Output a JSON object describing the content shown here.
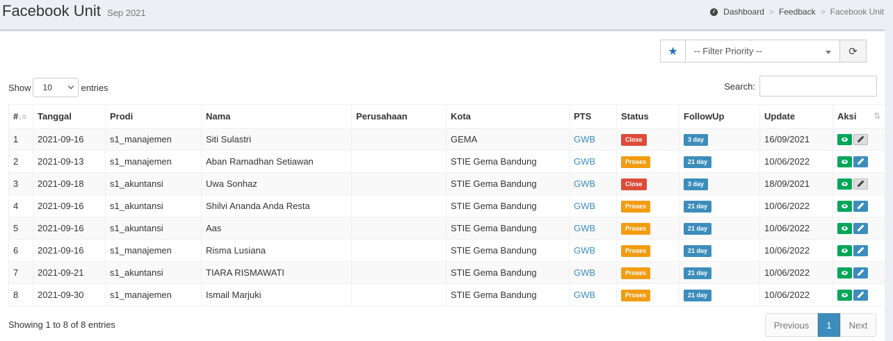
{
  "header": {
    "title": "Facebook Unit",
    "subtitle": "Sep 2021",
    "breadcrumb": [
      "Dashboard",
      "Feedback",
      "Facebook Unit"
    ],
    "breadcrumb_sep": ">"
  },
  "filter": {
    "star_icon": "★",
    "priority_placeholder": "-- Filter Priority --",
    "refresh_icon": "⟳"
  },
  "length": {
    "show_label": "Show",
    "value": "10",
    "entries_label": "entries"
  },
  "search": {
    "label": "Search:",
    "value": ""
  },
  "table": {
    "columns": [
      "#",
      "Tanggal",
      "Prodi",
      "Nama",
      "Perusahaan",
      "Kota",
      "PTS",
      "Status",
      "FollowUp",
      "Update",
      "Aksi"
    ],
    "sort_icon": "↓≡",
    "sort_both_icon": "⇅",
    "rows": [
      {
        "no": "1",
        "tanggal": "2021-09-16",
        "prodi": "s1_manajemen",
        "nama": "Siti Sulastri",
        "perusahaan": "",
        "kota": "GEMA",
        "pts": "GWB",
        "status": "Close",
        "followup": "3 day",
        "update": "16/09/2021",
        "edit_enabled": false
      },
      {
        "no": "2",
        "tanggal": "2021-09-13",
        "prodi": "s1_manajemen",
        "nama": "Aban Ramadhan Setiawan",
        "perusahaan": "",
        "kota": "STIE Gema Bandung",
        "pts": "GWB",
        "status": "Proses",
        "followup": "21 day",
        "update": "10/06/2022",
        "edit_enabled": true
      },
      {
        "no": "3",
        "tanggal": "2021-09-18",
        "prodi": "s1_akuntansi",
        "nama": "Uwa Sonhaz",
        "perusahaan": "",
        "kota": "STIE Gema Bandung",
        "pts": "GWB",
        "status": "Close",
        "followup": "3 day",
        "update": "18/09/2021",
        "edit_enabled": false
      },
      {
        "no": "4",
        "tanggal": "2021-09-16",
        "prodi": "s1_akuntansi",
        "nama": "Shilvi Ananda Anda Resta",
        "perusahaan": "",
        "kota": "STIE Gema Bandung",
        "pts": "GWB",
        "status": "Proses",
        "followup": "21 day",
        "update": "10/06/2022",
        "edit_enabled": true
      },
      {
        "no": "5",
        "tanggal": "2021-09-16",
        "prodi": "s1_akuntansi",
        "nama": "Aas",
        "perusahaan": "",
        "kota": "STIE Gema Bandung",
        "pts": "GWB",
        "status": "Proses",
        "followup": "21 day",
        "update": "10/06/2022",
        "edit_enabled": true
      },
      {
        "no": "6",
        "tanggal": "2021-09-16",
        "prodi": "s1_manajemen",
        "nama": "Risma Lusiana",
        "perusahaan": "",
        "kota": "STIE Gema Bandung",
        "pts": "GWB",
        "status": "Proses",
        "followup": "21 day",
        "update": "10/06/2022",
        "edit_enabled": true
      },
      {
        "no": "7",
        "tanggal": "2021-09-21",
        "prodi": "s1_akuntansi",
        "nama": "TIARA RISMAWATI",
        "perusahaan": "",
        "kota": "STIE Gema Bandung",
        "pts": "GWB",
        "status": "Proses",
        "followup": "21 day",
        "update": "10/06/2022",
        "edit_enabled": true
      },
      {
        "no": "8",
        "tanggal": "2021-09-30",
        "prodi": "s1_manajemen",
        "nama": "Ismail Marjuki",
        "perusahaan": "",
        "kota": "STIE Gema Bandung",
        "pts": "GWB",
        "status": "Proses",
        "followup": "21 day",
        "update": "10/06/2022",
        "edit_enabled": true
      }
    ]
  },
  "footer": {
    "info": "Showing 1 to 8 of 8 entries",
    "prev_label": "Previous",
    "current_page": "1",
    "next_label": "Next"
  },
  "colors": {
    "close": "#dd4b39",
    "proses": "#f39c12",
    "followup": "#3c8dbc",
    "view": "#00a65a",
    "edit": "#3c8dbc",
    "link": "#3c8dbc"
  }
}
